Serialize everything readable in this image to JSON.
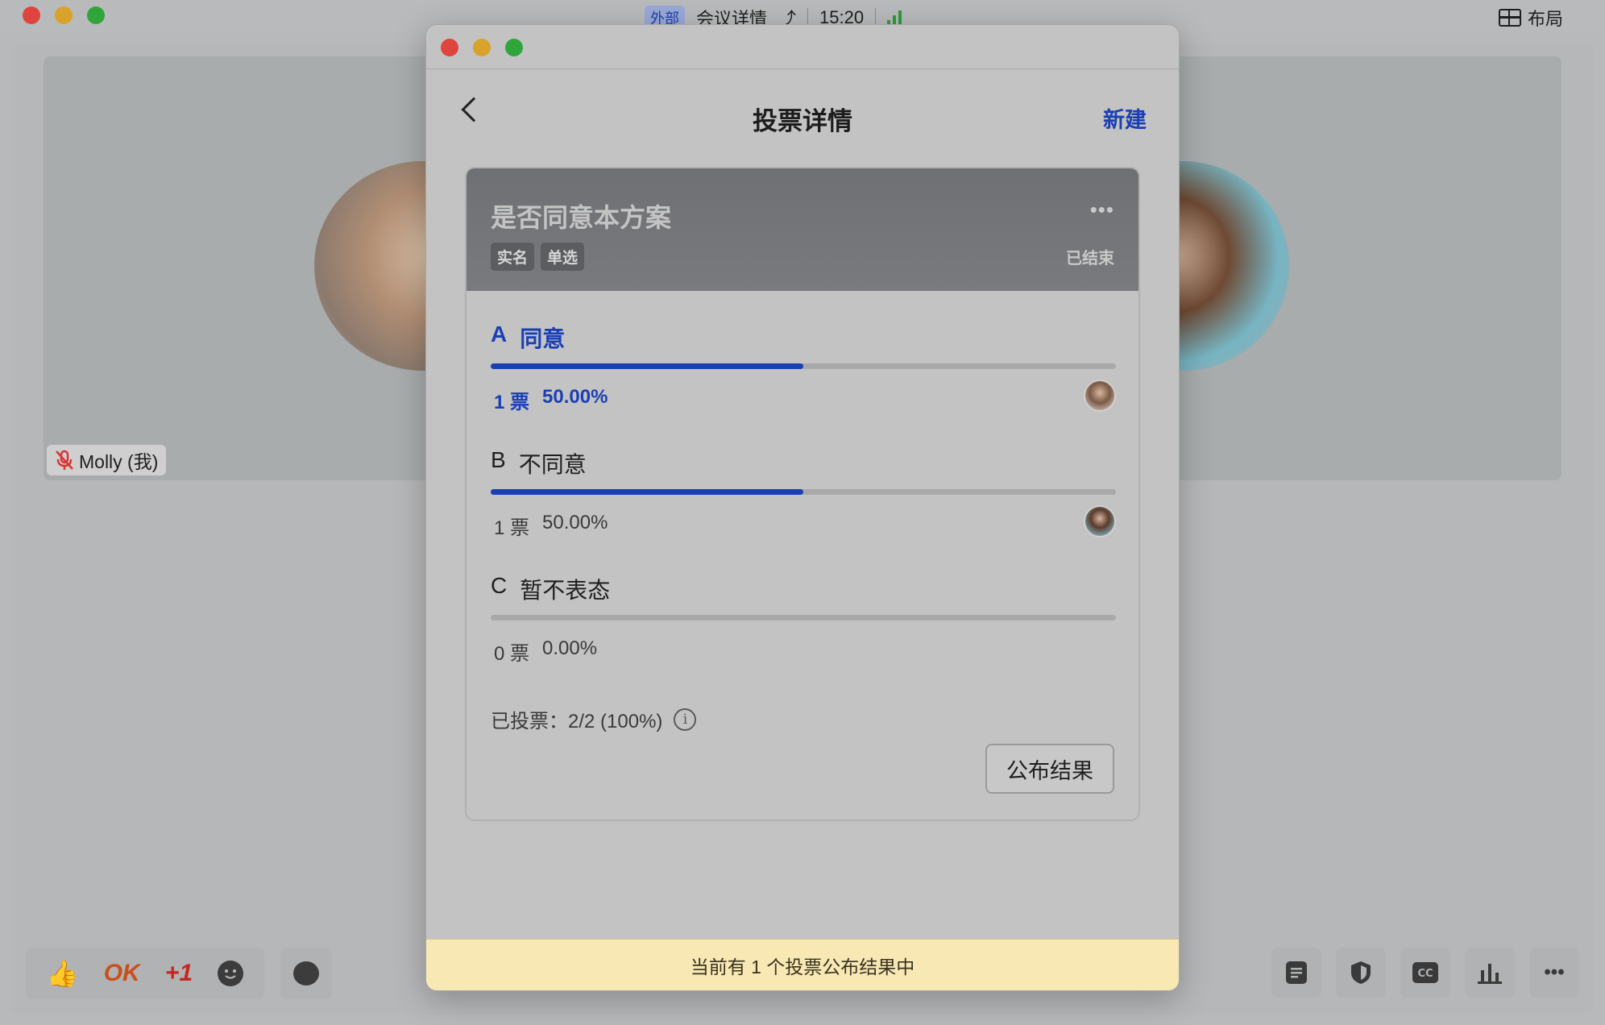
{
  "background": {
    "title_badge": "外部",
    "title": "会议详情",
    "time": "15:20",
    "layout_label": "布局",
    "participant_name": "Molly (我)",
    "reactions": {
      "ok": "OK",
      "plus_one": "+1"
    }
  },
  "dialog": {
    "title": "投票详情",
    "new_label": "新建",
    "poll": {
      "question": "是否同意本方案",
      "tags": [
        "实名",
        "单选"
      ],
      "status": "已结束",
      "options": [
        {
          "letter": "A",
          "label": "同意",
          "votes": "1 票",
          "percent_text": "50.00%",
          "fill": 0.5,
          "selected": true
        },
        {
          "letter": "B",
          "label": "不同意",
          "votes": "1 票",
          "percent_text": "50.00%",
          "fill": 0.5,
          "selected": false
        },
        {
          "letter": "C",
          "label": "暂不表态",
          "votes": "0 票",
          "percent_text": "0.00%",
          "fill": 0,
          "selected": false
        }
      ],
      "voted_summary": "已投票：2/2 (100%)",
      "publish_label": "公布结果"
    },
    "notice": "当前有 1 个投票公布结果中"
  },
  "colors": {
    "accent": "#1a3fb5",
    "notice_bg": "#f7e8b4"
  }
}
